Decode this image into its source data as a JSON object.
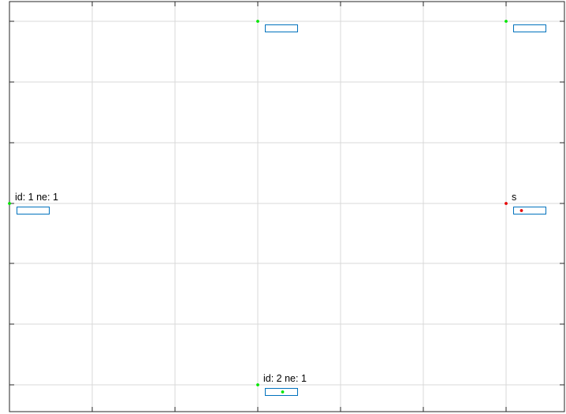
{
  "plot": {
    "grid": true,
    "colors": {
      "grid": "#d9d9d9",
      "axis": "#262626",
      "active_node": "#00e600",
      "source_node": "#e60000",
      "box": "#0072bd",
      "background": "#ffffff"
    },
    "nodes": [
      {
        "id": "n-left",
        "label": "id: 1 ne: 1",
        "status": "active",
        "has_marker_in_box": false
      },
      {
        "id": "n-top-mid",
        "label": "",
        "status": "active",
        "has_marker_in_box": false
      },
      {
        "id": "n-top-right",
        "label": "",
        "status": "active",
        "has_marker_in_box": false
      },
      {
        "id": "n-right",
        "label": "s",
        "status": "source",
        "has_marker_in_box": true
      },
      {
        "id": "n-bottom-mid",
        "label": "id: 2 ne: 1",
        "status": "active",
        "has_marker_in_box": true
      }
    ]
  }
}
